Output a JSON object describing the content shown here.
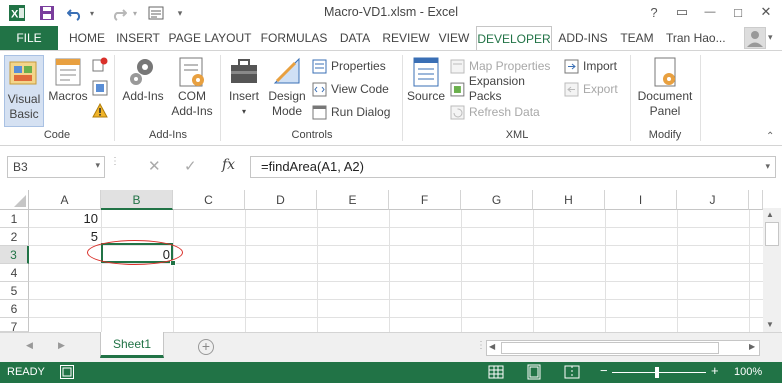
{
  "window": {
    "title": "Macro-VD1.xlsm - Excel",
    "help_glyph": "?",
    "restore_glyph": "▭",
    "minimize_glyph": "—",
    "max_glyph": "□",
    "close_glyph": "✕"
  },
  "qat": {
    "icons": [
      "excel-logo-icon",
      "save-icon",
      "undo-icon",
      "redo-icon",
      "form-icon",
      "customize-qat-icon"
    ]
  },
  "tabs": {
    "file": "FILE",
    "items": [
      "HOME",
      "INSERT",
      "PAGE LAYOUT",
      "FORMULAS",
      "DATA",
      "REVIEW",
      "VIEW",
      "DEVELOPER",
      "ADD-INS",
      "TEAM"
    ],
    "active": "DEVELOPER",
    "user": "Tran Hao..."
  },
  "ribbon": {
    "code": {
      "label": "Code",
      "visual_basic": "Visual Basic",
      "visual_basic_l1": "Visual",
      "visual_basic_l2": "Basic",
      "macros": "Macros"
    },
    "addins": {
      "label": "Add-Ins",
      "addins_btn": "Add-Ins",
      "com_l1": "COM",
      "com_l2": "Add-Ins"
    },
    "controls": {
      "label": "Controls",
      "insert": "Insert",
      "design_l1": "Design",
      "design_l2": "Mode",
      "properties": "Properties",
      "view_code": "View Code",
      "run_dialog": "Run Dialog"
    },
    "xml": {
      "label": "XML",
      "source": "Source",
      "map_properties": "Map Properties",
      "expansion_packs": "Expansion Packs",
      "refresh_data": "Refresh Data",
      "import": "Import",
      "export": "Export"
    },
    "modify": {
      "label": "Modify",
      "doc_l1": "Document",
      "doc_l2": "Panel"
    }
  },
  "formula_bar": {
    "name_box": "B3",
    "cancel_glyph": "✕",
    "enter_glyph": "✓",
    "fx": "fx",
    "formula": "=findArea(A1, A2)"
  },
  "grid": {
    "columns": [
      "A",
      "B",
      "C",
      "D",
      "E",
      "F",
      "G",
      "H",
      "I",
      "J"
    ],
    "selected_column": "B",
    "rows": [
      "1",
      "2",
      "3",
      "4",
      "5",
      "6",
      "7"
    ],
    "selected_row": "3",
    "cells": {
      "A1": "10",
      "A2": "5",
      "B3": "0"
    }
  },
  "sheets": {
    "tabs": [
      "Sheet1"
    ],
    "active": "Sheet1",
    "add_glyph": "+"
  },
  "status": {
    "ready": "READY",
    "zoom": "100%",
    "zoom_level": 1.0
  },
  "colors": {
    "accent": "#217346",
    "annotation": "#d9302a"
  }
}
